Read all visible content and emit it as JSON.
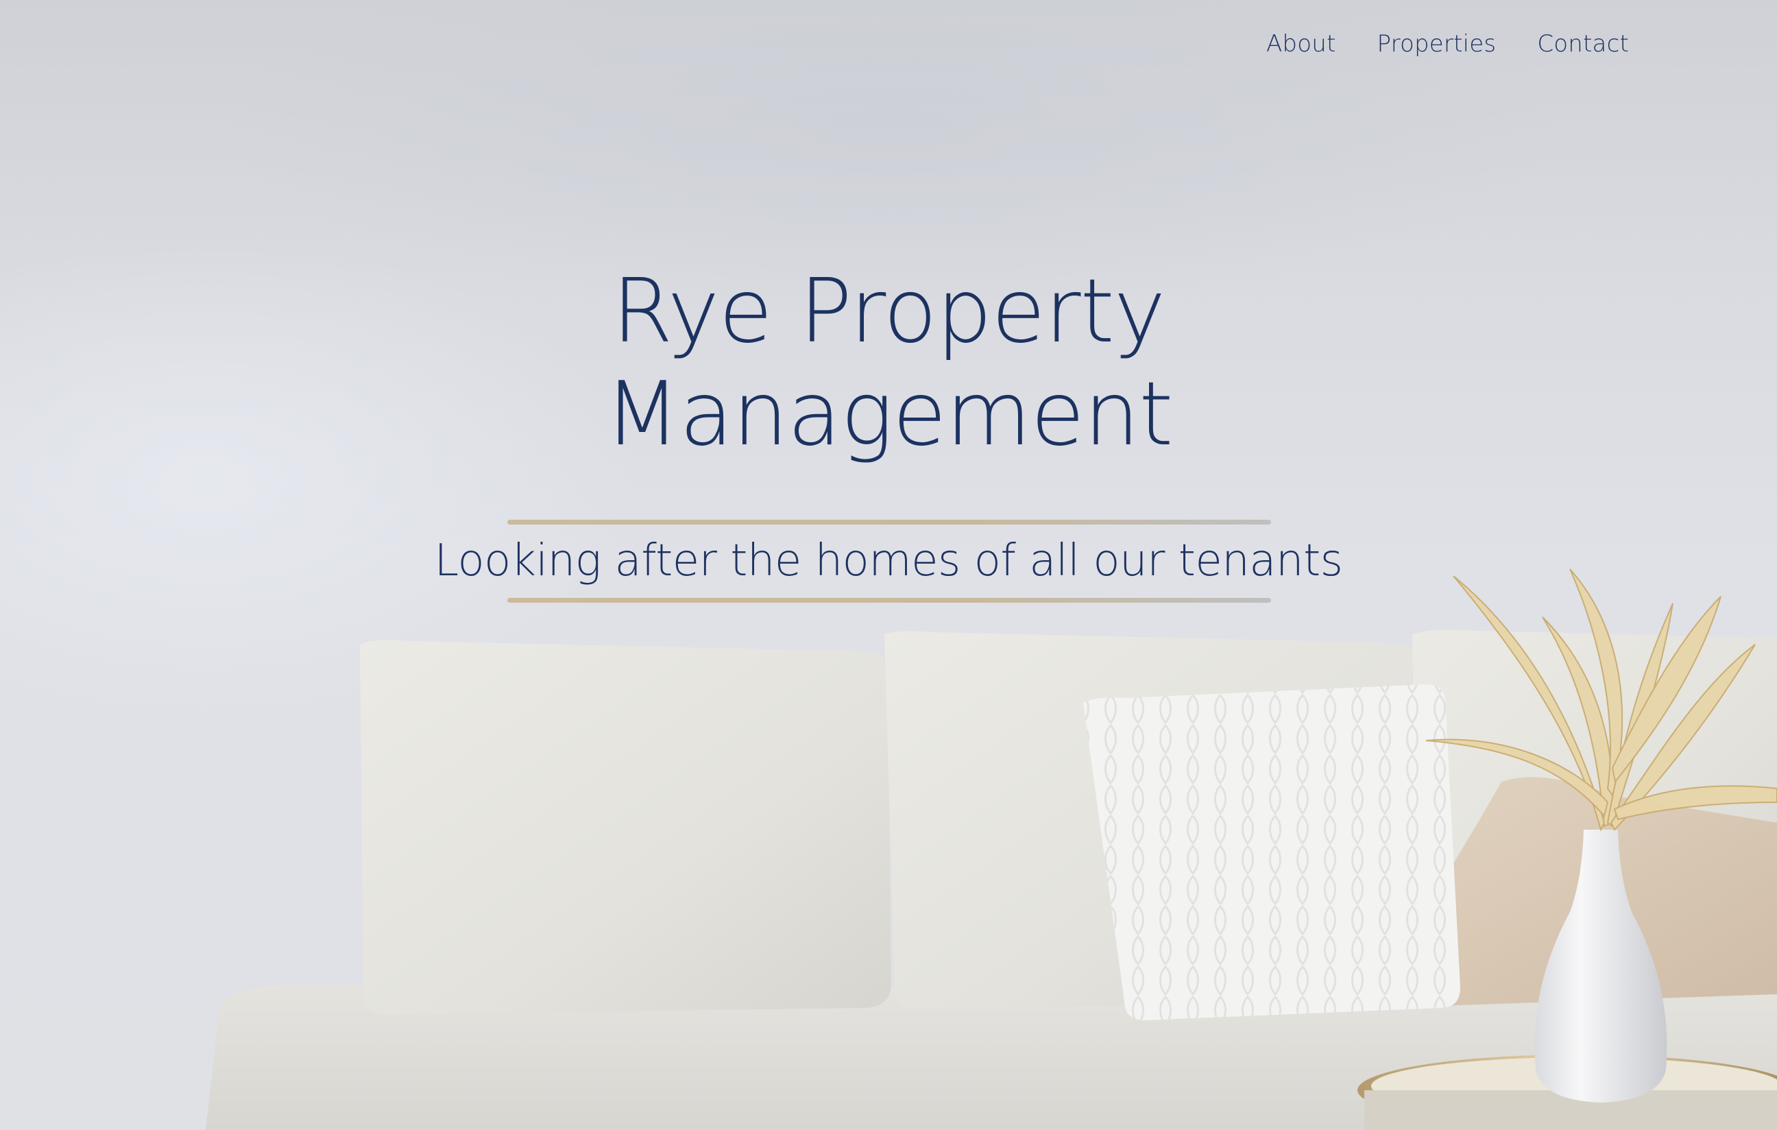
{
  "nav": {
    "items": [
      {
        "label": "About"
      },
      {
        "label": "Properties"
      },
      {
        "label": "Contact"
      }
    ]
  },
  "hero": {
    "title_line1": "Rye Property",
    "title_line2": "Management",
    "tagline": "Looking after the homes of all our tenants"
  },
  "colors": {
    "brand_navy": "#1d3160",
    "accent_gold": "#c8b99b",
    "background": "#dcdee4"
  }
}
